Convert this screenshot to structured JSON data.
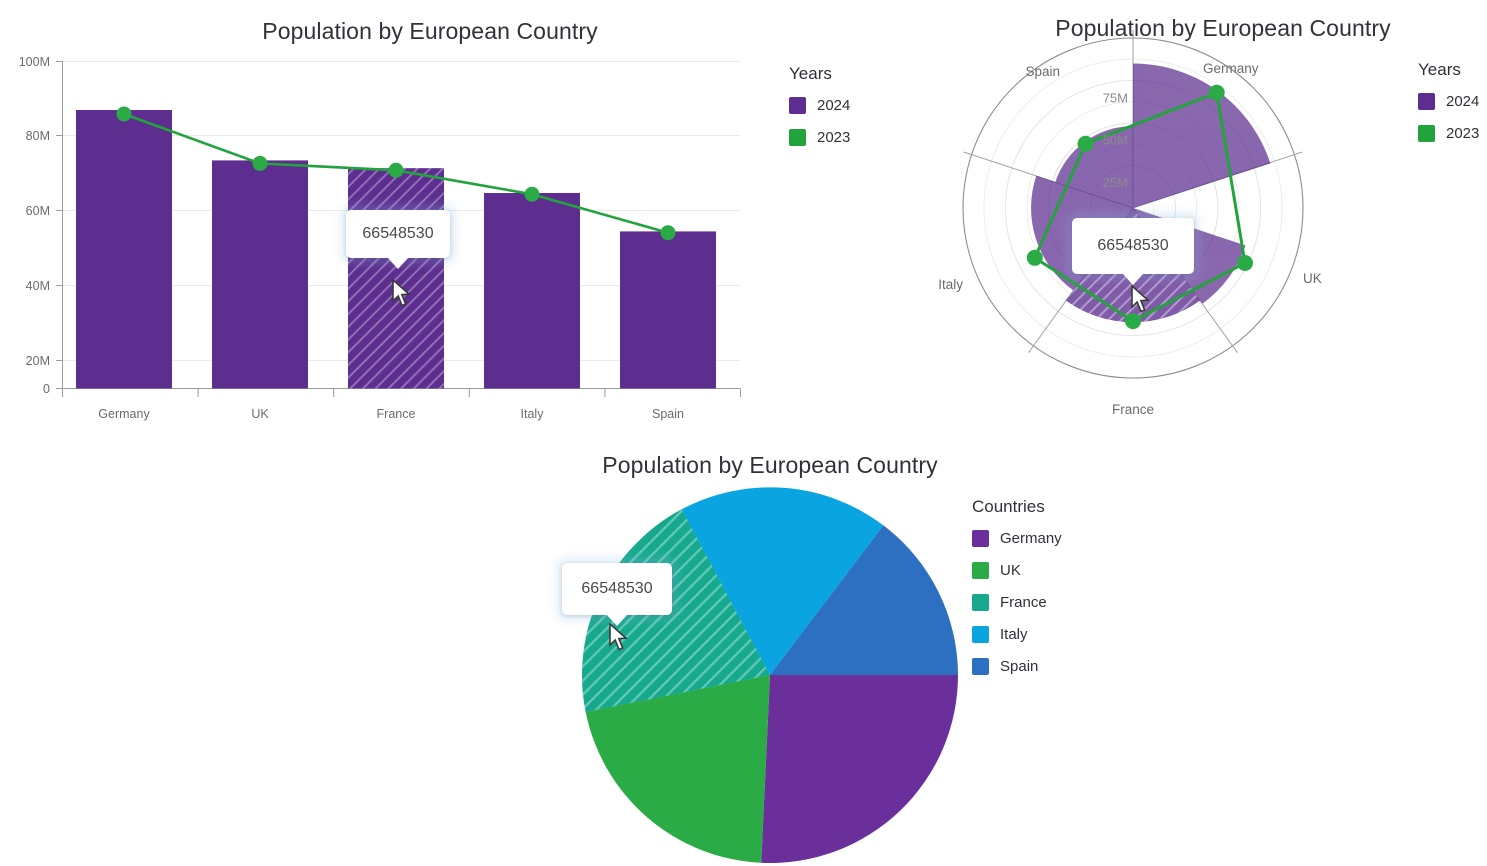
{
  "colors": {
    "purple_2024": "#5d2e8f",
    "green_2023": "#22a33c",
    "pie_germany": "#6a2f9b",
    "pie_uk": "#2aab45",
    "pie_france": "#17a98d",
    "pie_italy": "#0aa4e0",
    "pie_spain": "#2d6fc0",
    "title": "#31313b",
    "axis_text": "#6b6b6b",
    "grid": "#e6e6e6",
    "tooltip_text": "#4a4a4a"
  },
  "bar_chart": {
    "title": "Population by European Country",
    "legend": {
      "title": "Years",
      "items": [
        {
          "label": "2024",
          "color": "#5d2e8f"
        },
        {
          "label": "2023",
          "color": "#22a33c"
        }
      ]
    },
    "tooltip": {
      "value": "66548530",
      "hover_category": "France"
    }
  },
  "polar_chart": {
    "title": "Population by European Country",
    "legend": {
      "title": "Years",
      "items": [
        {
          "label": "2024",
          "color": "#5d2e8f"
        },
        {
          "label": "2023",
          "color": "#22a33c"
        }
      ]
    },
    "tooltip": {
      "value": "66548530",
      "hover_category": "France"
    },
    "radial_ticks": [
      "25M",
      "50M",
      "75M"
    ],
    "angular_labels": [
      "Germany",
      "UK",
      "France",
      "Italy",
      "Spain"
    ]
  },
  "pie_chart": {
    "title": "Population by European Country",
    "legend": {
      "title": "Countries",
      "items": [
        {
          "label": "Germany",
          "color": "#6a2f9b"
        },
        {
          "label": "UK",
          "color": "#2aab45"
        },
        {
          "label": "France",
          "color": "#17a98d"
        },
        {
          "label": "Italy",
          "color": "#0aa4e0"
        },
        {
          "label": "Spain",
          "color": "#2d6fc0"
        }
      ]
    },
    "tooltip": {
      "value": "66548530",
      "hover_slice": "France"
    }
  },
  "chart_data": [
    {
      "type": "bar",
      "id": "bar-line-combo",
      "title": "Population by European Country",
      "categories": [
        "Germany",
        "UK",
        "France",
        "Italy",
        "Spain"
      ],
      "series": [
        {
          "name": "2024",
          "kind": "bar",
          "color": "#5d2e8f",
          "values": [
            85000000,
            69600000,
            67200000,
            59800000,
            48200000
          ]
        },
        {
          "name": "2023",
          "kind": "line",
          "color": "#22a33c",
          "values": [
            83800000,
            68700000,
            66548530,
            59400000,
            47500000
          ]
        }
      ],
      "xlabel": "",
      "ylabel": "",
      "ylim": [
        0,
        100000000
      ],
      "ytick_labels": [
        "0",
        "20M",
        "40M",
        "60M",
        "80M",
        "100M"
      ],
      "ytick_values": [
        0,
        20000000,
        40000000,
        60000000,
        80000000,
        100000000
      ],
      "grid": true,
      "legend_position": "right",
      "legend_title": "Years",
      "hover": {
        "category": "France",
        "series": "2023",
        "label": "66548530"
      }
    },
    {
      "type": "bar",
      "id": "polar-bar-line-combo",
      "title": "Population by European Country",
      "coordinate_system": "polar",
      "categories": [
        "Germany",
        "UK",
        "France",
        "Italy",
        "Spain"
      ],
      "series": [
        {
          "name": "2024",
          "kind": "polar-bar",
          "color": "#5d2e8f",
          "values": [
            85000000,
            69600000,
            67200000,
            59800000,
            48200000
          ]
        },
        {
          "name": "2023",
          "kind": "polar-line",
          "color": "#22a33c",
          "values": [
            83800000,
            68700000,
            66548530,
            59400000,
            47500000
          ]
        }
      ],
      "rlim": [
        0,
        100000000
      ],
      "rtick_labels": [
        "25M",
        "50M",
        "75M"
      ],
      "rtick_values": [
        25000000,
        50000000,
        75000000
      ],
      "grid": true,
      "legend_position": "right",
      "legend_title": "Years",
      "hover": {
        "category": "France",
        "series": "2023",
        "label": "66548530"
      }
    },
    {
      "type": "pie",
      "id": "population-pie",
      "title": "Population by European Country",
      "labels": [
        "Germany",
        "UK",
        "France",
        "Italy",
        "Spain"
      ],
      "values": [
        85000000,
        69600000,
        67200000,
        59800000,
        48200000
      ],
      "colors": [
        "#6a2f9b",
        "#2aab45",
        "#17a98d",
        "#0aa4e0",
        "#2d6fc0"
      ],
      "start_angle_deg": 0,
      "direction": "clockwise",
      "legend_position": "right",
      "legend_title": "Countries",
      "hover": {
        "slice": "France",
        "label": "66548530"
      }
    }
  ]
}
